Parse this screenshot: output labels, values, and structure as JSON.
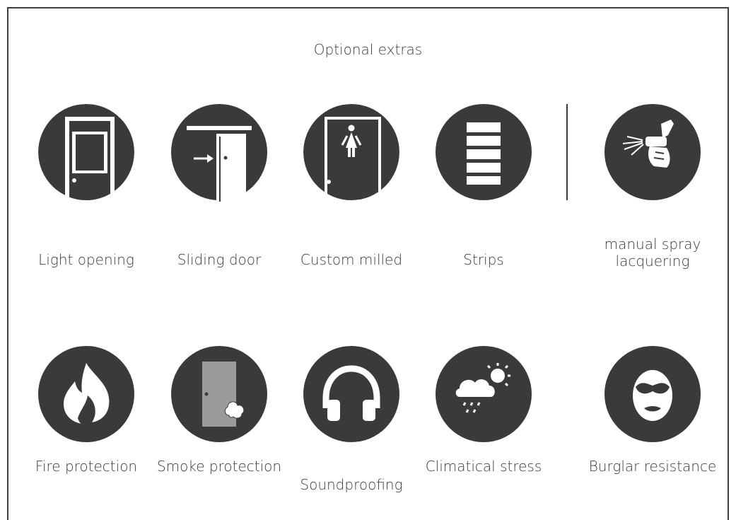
{
  "page": {
    "title": "Optional extras"
  },
  "colors": {
    "icon_bg": "#3a3a3a",
    "frame": "#3f3f3f",
    "text": "#3a3a3a"
  },
  "options_row1": [
    {
      "label": "Light opening",
      "icon": "light-opening-icon"
    },
    {
      "label": "Sliding door",
      "icon": "sliding-door-icon"
    },
    {
      "label": "Custom milled",
      "icon": "custom-milled-icon"
    },
    {
      "label": "Strips",
      "icon": "strips-icon"
    },
    {
      "label": "manual spray lacquering",
      "icon": "spray-gun-icon"
    }
  ],
  "options_row2": [
    {
      "label": "Fire protection",
      "icon": "flame-icon"
    },
    {
      "label": "Smoke protection",
      "icon": "smoke-door-icon"
    },
    {
      "label": "Soundproofing",
      "icon": "headphones-icon"
    },
    {
      "label": "Climatical stress",
      "icon": "weather-icon"
    },
    {
      "label": "Burglar resistance",
      "icon": "burglar-mask-icon"
    }
  ]
}
